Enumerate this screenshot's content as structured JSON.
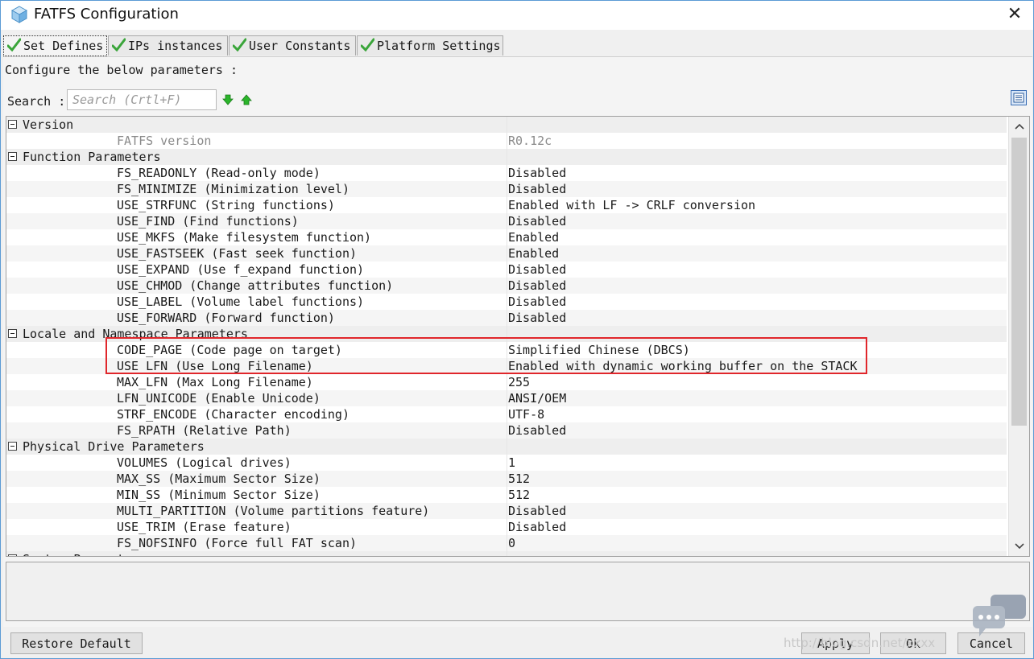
{
  "window": {
    "title": "FATFS Configuration",
    "close_label": "✕"
  },
  "tabs": [
    {
      "label": "Set Defines",
      "active": true
    },
    {
      "label": "IPs instances",
      "active": false
    },
    {
      "label": "User Constants",
      "active": false
    },
    {
      "label": "Platform Settings",
      "active": false
    }
  ],
  "configure_label": "Configure the below parameters :",
  "search": {
    "label": "Search :",
    "placeholder": "Search (Crtl+F)"
  },
  "groups": [
    {
      "name": "Version",
      "params": [
        {
          "name": "FATFS version",
          "value": "R0.12c",
          "disabled": true
        }
      ]
    },
    {
      "name": "Function Parameters",
      "params": [
        {
          "name": "FS_READONLY (Read-only mode)",
          "value": "Disabled"
        },
        {
          "name": "FS_MINIMIZE (Minimization level)",
          "value": "Disabled"
        },
        {
          "name": "USE_STRFUNC (String functions)",
          "value": "Enabled with LF -> CRLF conversion"
        },
        {
          "name": "USE_FIND (Find functions)",
          "value": "Disabled"
        },
        {
          "name": "USE_MKFS (Make filesystem function)",
          "value": "Enabled"
        },
        {
          "name": "USE_FASTSEEK (Fast seek function)",
          "value": "Enabled"
        },
        {
          "name": "USE_EXPAND (Use f_expand function)",
          "value": "Disabled"
        },
        {
          "name": "USE_CHMOD (Change attributes function)",
          "value": "Disabled"
        },
        {
          "name": "USE_LABEL (Volume label functions)",
          "value": "Disabled"
        },
        {
          "name": "USE_FORWARD (Forward function)",
          "value": "Disabled"
        }
      ]
    },
    {
      "name": "Locale and Namespace Parameters",
      "params": [
        {
          "name": "CODE_PAGE (Code page on target)",
          "value": "Simplified Chinese (DBCS)"
        },
        {
          "name": "USE_LFN (Use Long Filename)",
          "value": "Enabled with dynamic working buffer on the STACK"
        },
        {
          "name": "MAX_LFN (Max Long Filename)",
          "value": "255"
        },
        {
          "name": "LFN_UNICODE (Enable Unicode)",
          "value": "ANSI/OEM"
        },
        {
          "name": "STRF_ENCODE (Character encoding)",
          "value": "UTF-8"
        },
        {
          "name": "FS_RPATH (Relative Path)",
          "value": "Disabled"
        }
      ]
    },
    {
      "name": "Physical Drive Parameters",
      "params": [
        {
          "name": "VOLUMES (Logical drives)",
          "value": "1"
        },
        {
          "name": "MAX_SS (Maximum Sector Size)",
          "value": "512"
        },
        {
          "name": "MIN_SS (Minimum Sector Size)",
          "value": "512"
        },
        {
          "name": "MULTI_PARTITION (Volume partitions feature)",
          "value": "Disabled"
        },
        {
          "name": "USE_TRIM (Erase feature)",
          "value": "Disabled"
        },
        {
          "name": "FS_NOFSINFO (Force full FAT scan)",
          "value": "0"
        }
      ]
    },
    {
      "name": "System Parameters",
      "params": []
    }
  ],
  "buttons": {
    "restore_default": "Restore Default",
    "apply": "Apply",
    "ok": "Ok",
    "cancel": "Cancel"
  },
  "watermark": "http://blog.csdn.net/xxxx",
  "colors": {
    "highlight_border": "#e0262b",
    "check_green": "#3aa53a",
    "arrow_green": "#2bb52b",
    "window_border": "#5b9bd5"
  }
}
